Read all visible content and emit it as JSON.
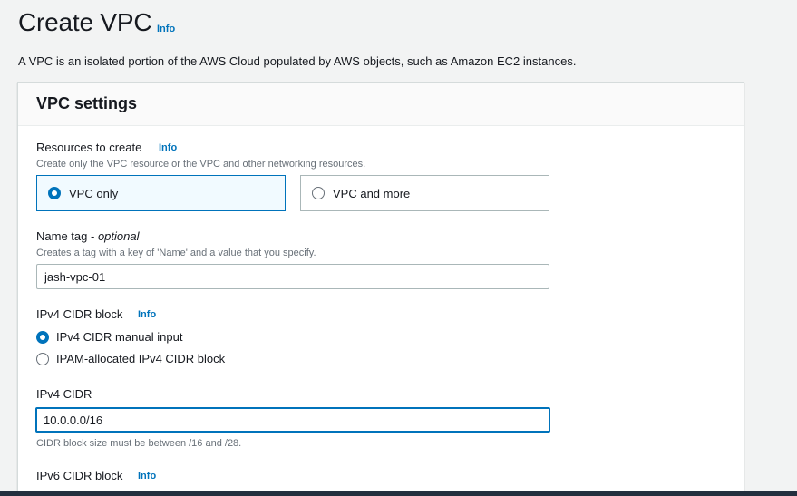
{
  "header": {
    "title": "Create VPC",
    "info": "Info",
    "description": "A VPC is an isolated portion of the AWS Cloud populated by AWS objects, such as Amazon EC2 instances."
  },
  "panel": {
    "title": "VPC settings",
    "resources": {
      "label": "Resources to create",
      "info": "Info",
      "hint": "Create only the VPC resource or the VPC and other networking resources.",
      "options": [
        "VPC only",
        "VPC and more"
      ],
      "selected": "VPC only"
    },
    "name_tag": {
      "label": "Name tag",
      "optional": "optional",
      "separator": " - ",
      "hint": "Creates a tag with a key of 'Name' and a value that you specify.",
      "value": "jash-vpc-01"
    },
    "ipv4_block": {
      "label": "IPv4 CIDR block",
      "info": "Info",
      "options": [
        "IPv4 CIDR manual input",
        "IPAM-allocated IPv4 CIDR block"
      ],
      "selected": "IPv4 CIDR manual input"
    },
    "ipv4_cidr": {
      "label": "IPv4 CIDR",
      "value": "10.0.0.0/16",
      "hint": "CIDR block size must be between /16 and /28."
    },
    "ipv6_block": {
      "label": "IPv6 CIDR block",
      "info": "Info"
    }
  },
  "colors": {
    "accent": "#0073bb",
    "selected_tile_bg": "#f1faff",
    "bottom_bar": "#232f3e"
  },
  "icons": {
    "radio_checked": "radio-checked-icon",
    "radio_unchecked": "radio-unchecked-icon"
  }
}
